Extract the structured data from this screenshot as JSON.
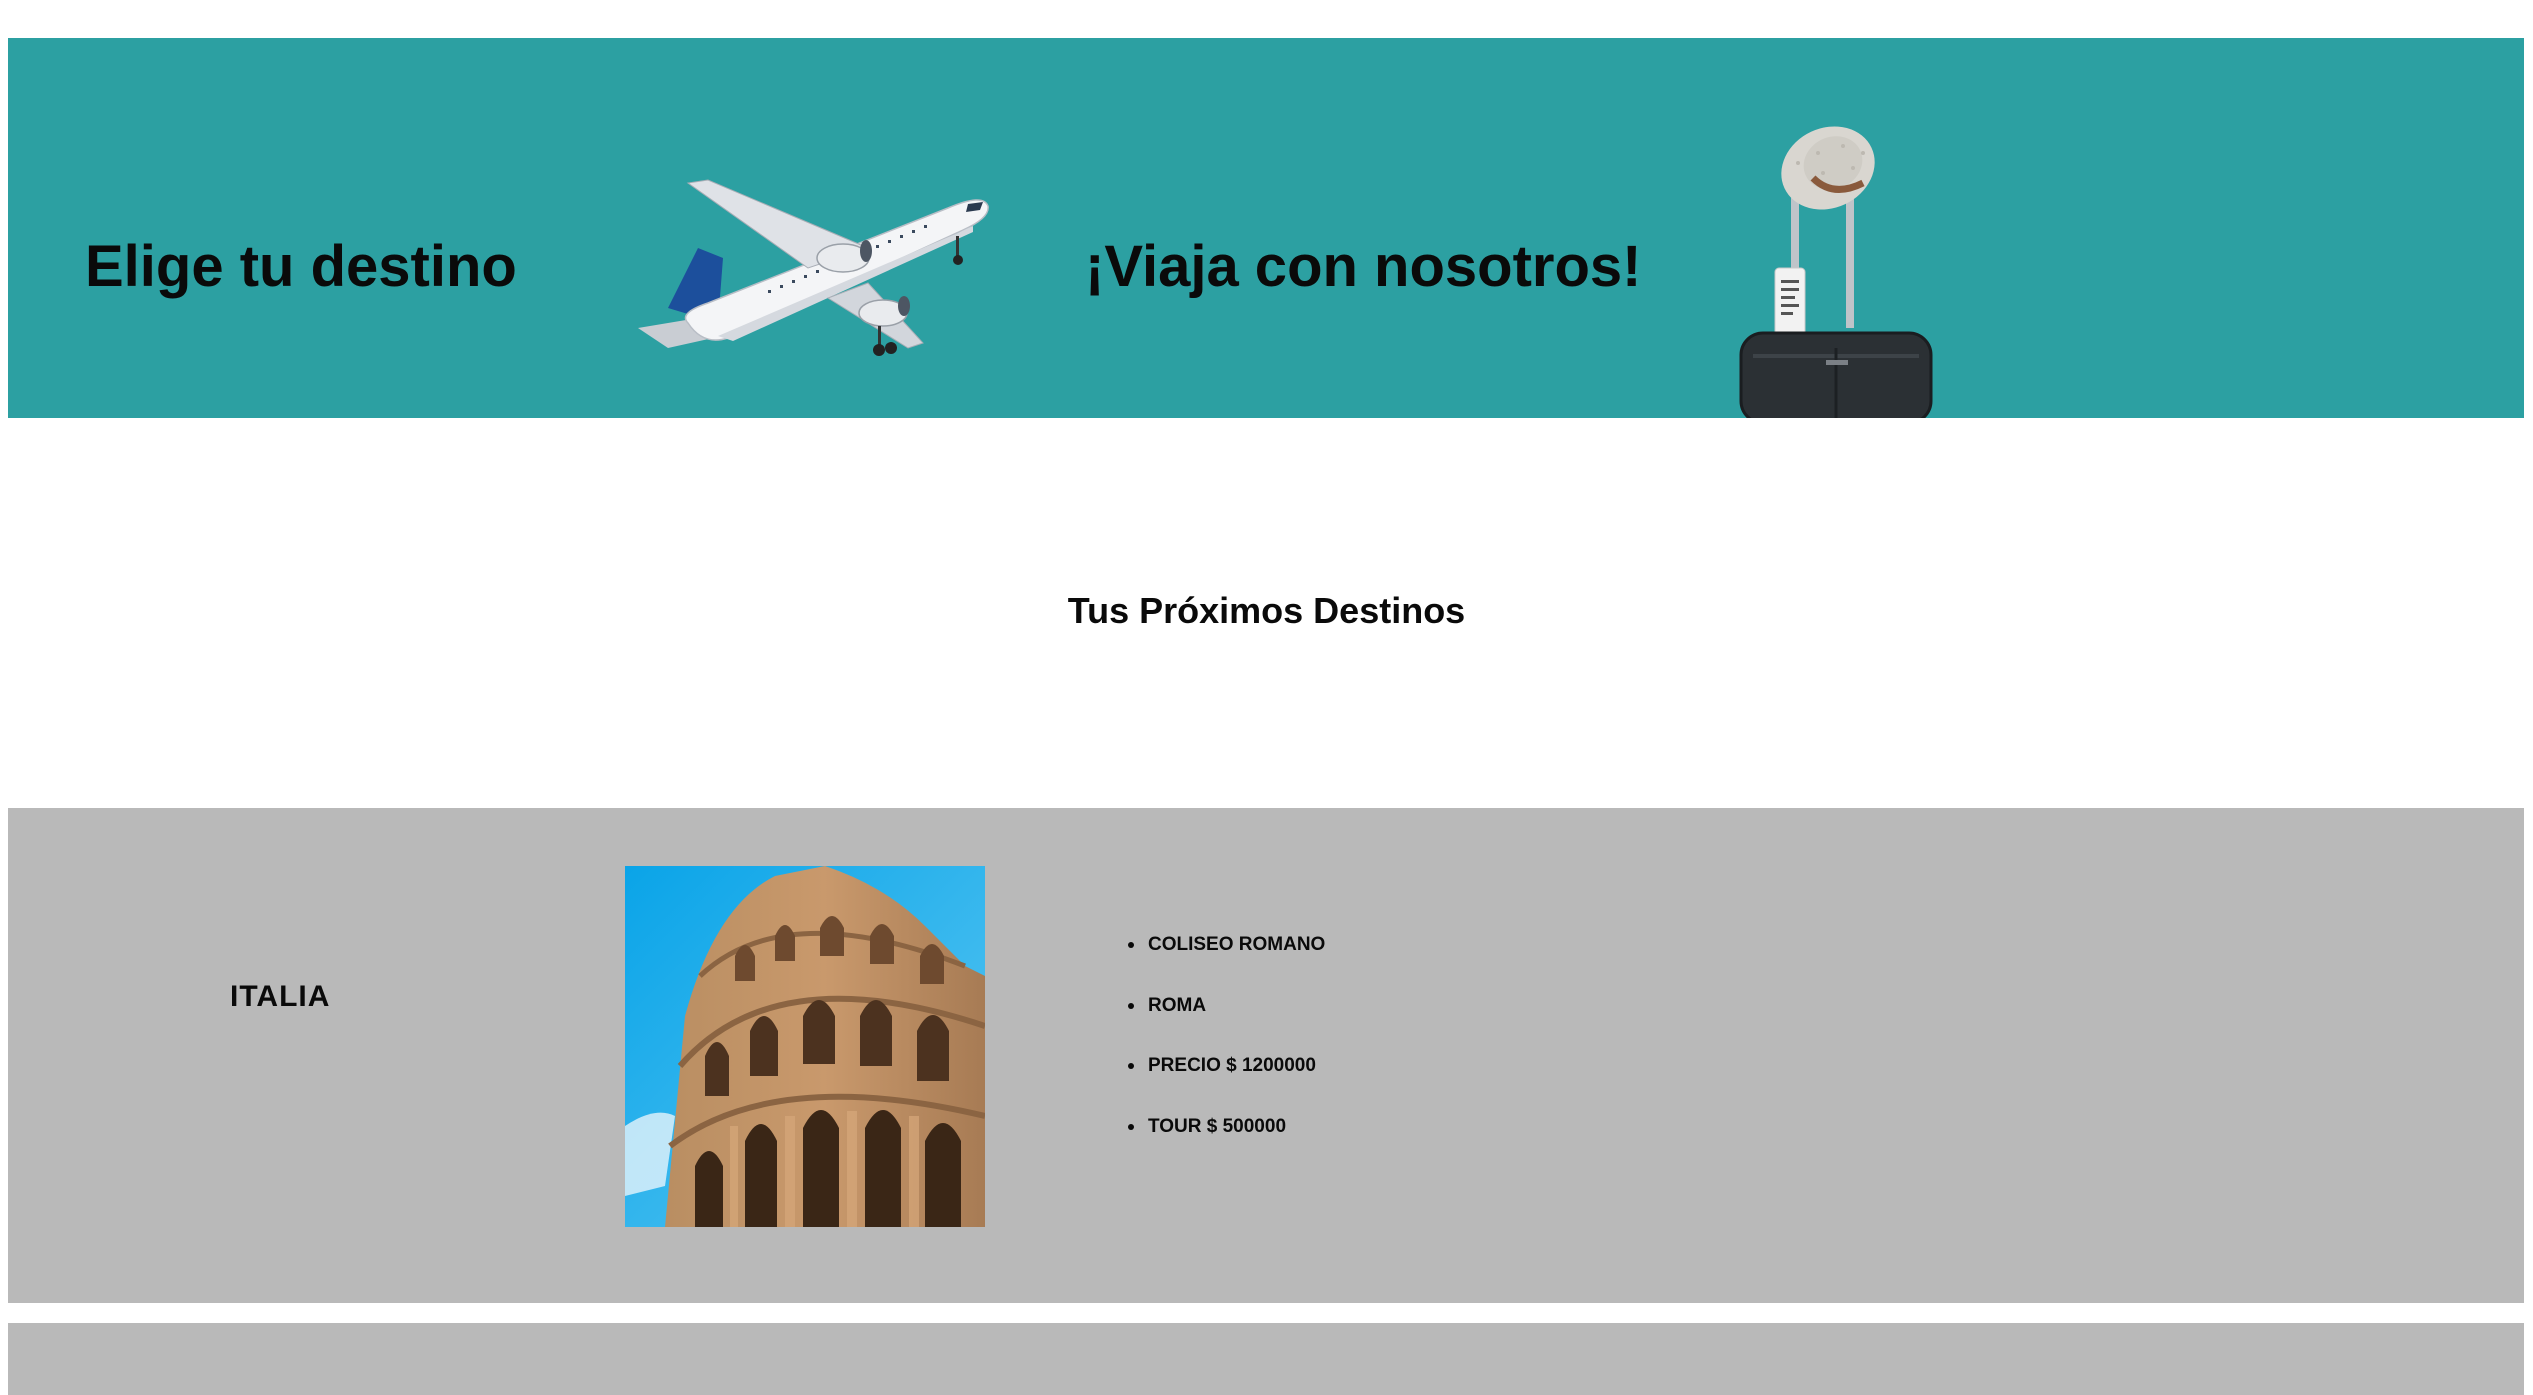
{
  "header": {
    "title_left": "Elige tu destino",
    "title_right": "¡Viaja con nosotros!",
    "plane_image": "airplane-image",
    "suitcase_image": "suitcase-with-hat-image",
    "background_color": "#2ca0a2"
  },
  "section": {
    "title": "Tus Próximos Destinos"
  },
  "destinations": [
    {
      "country": "ITALIA",
      "image": "colosseum-image",
      "details": [
        "COLISEO ROMANO",
        "ROMA",
        "PRECIO $ 1200000",
        "TOUR $ 500000"
      ]
    }
  ],
  "colors": {
    "card_background": "#b9b9b9",
    "page_background": "#ffffff"
  }
}
